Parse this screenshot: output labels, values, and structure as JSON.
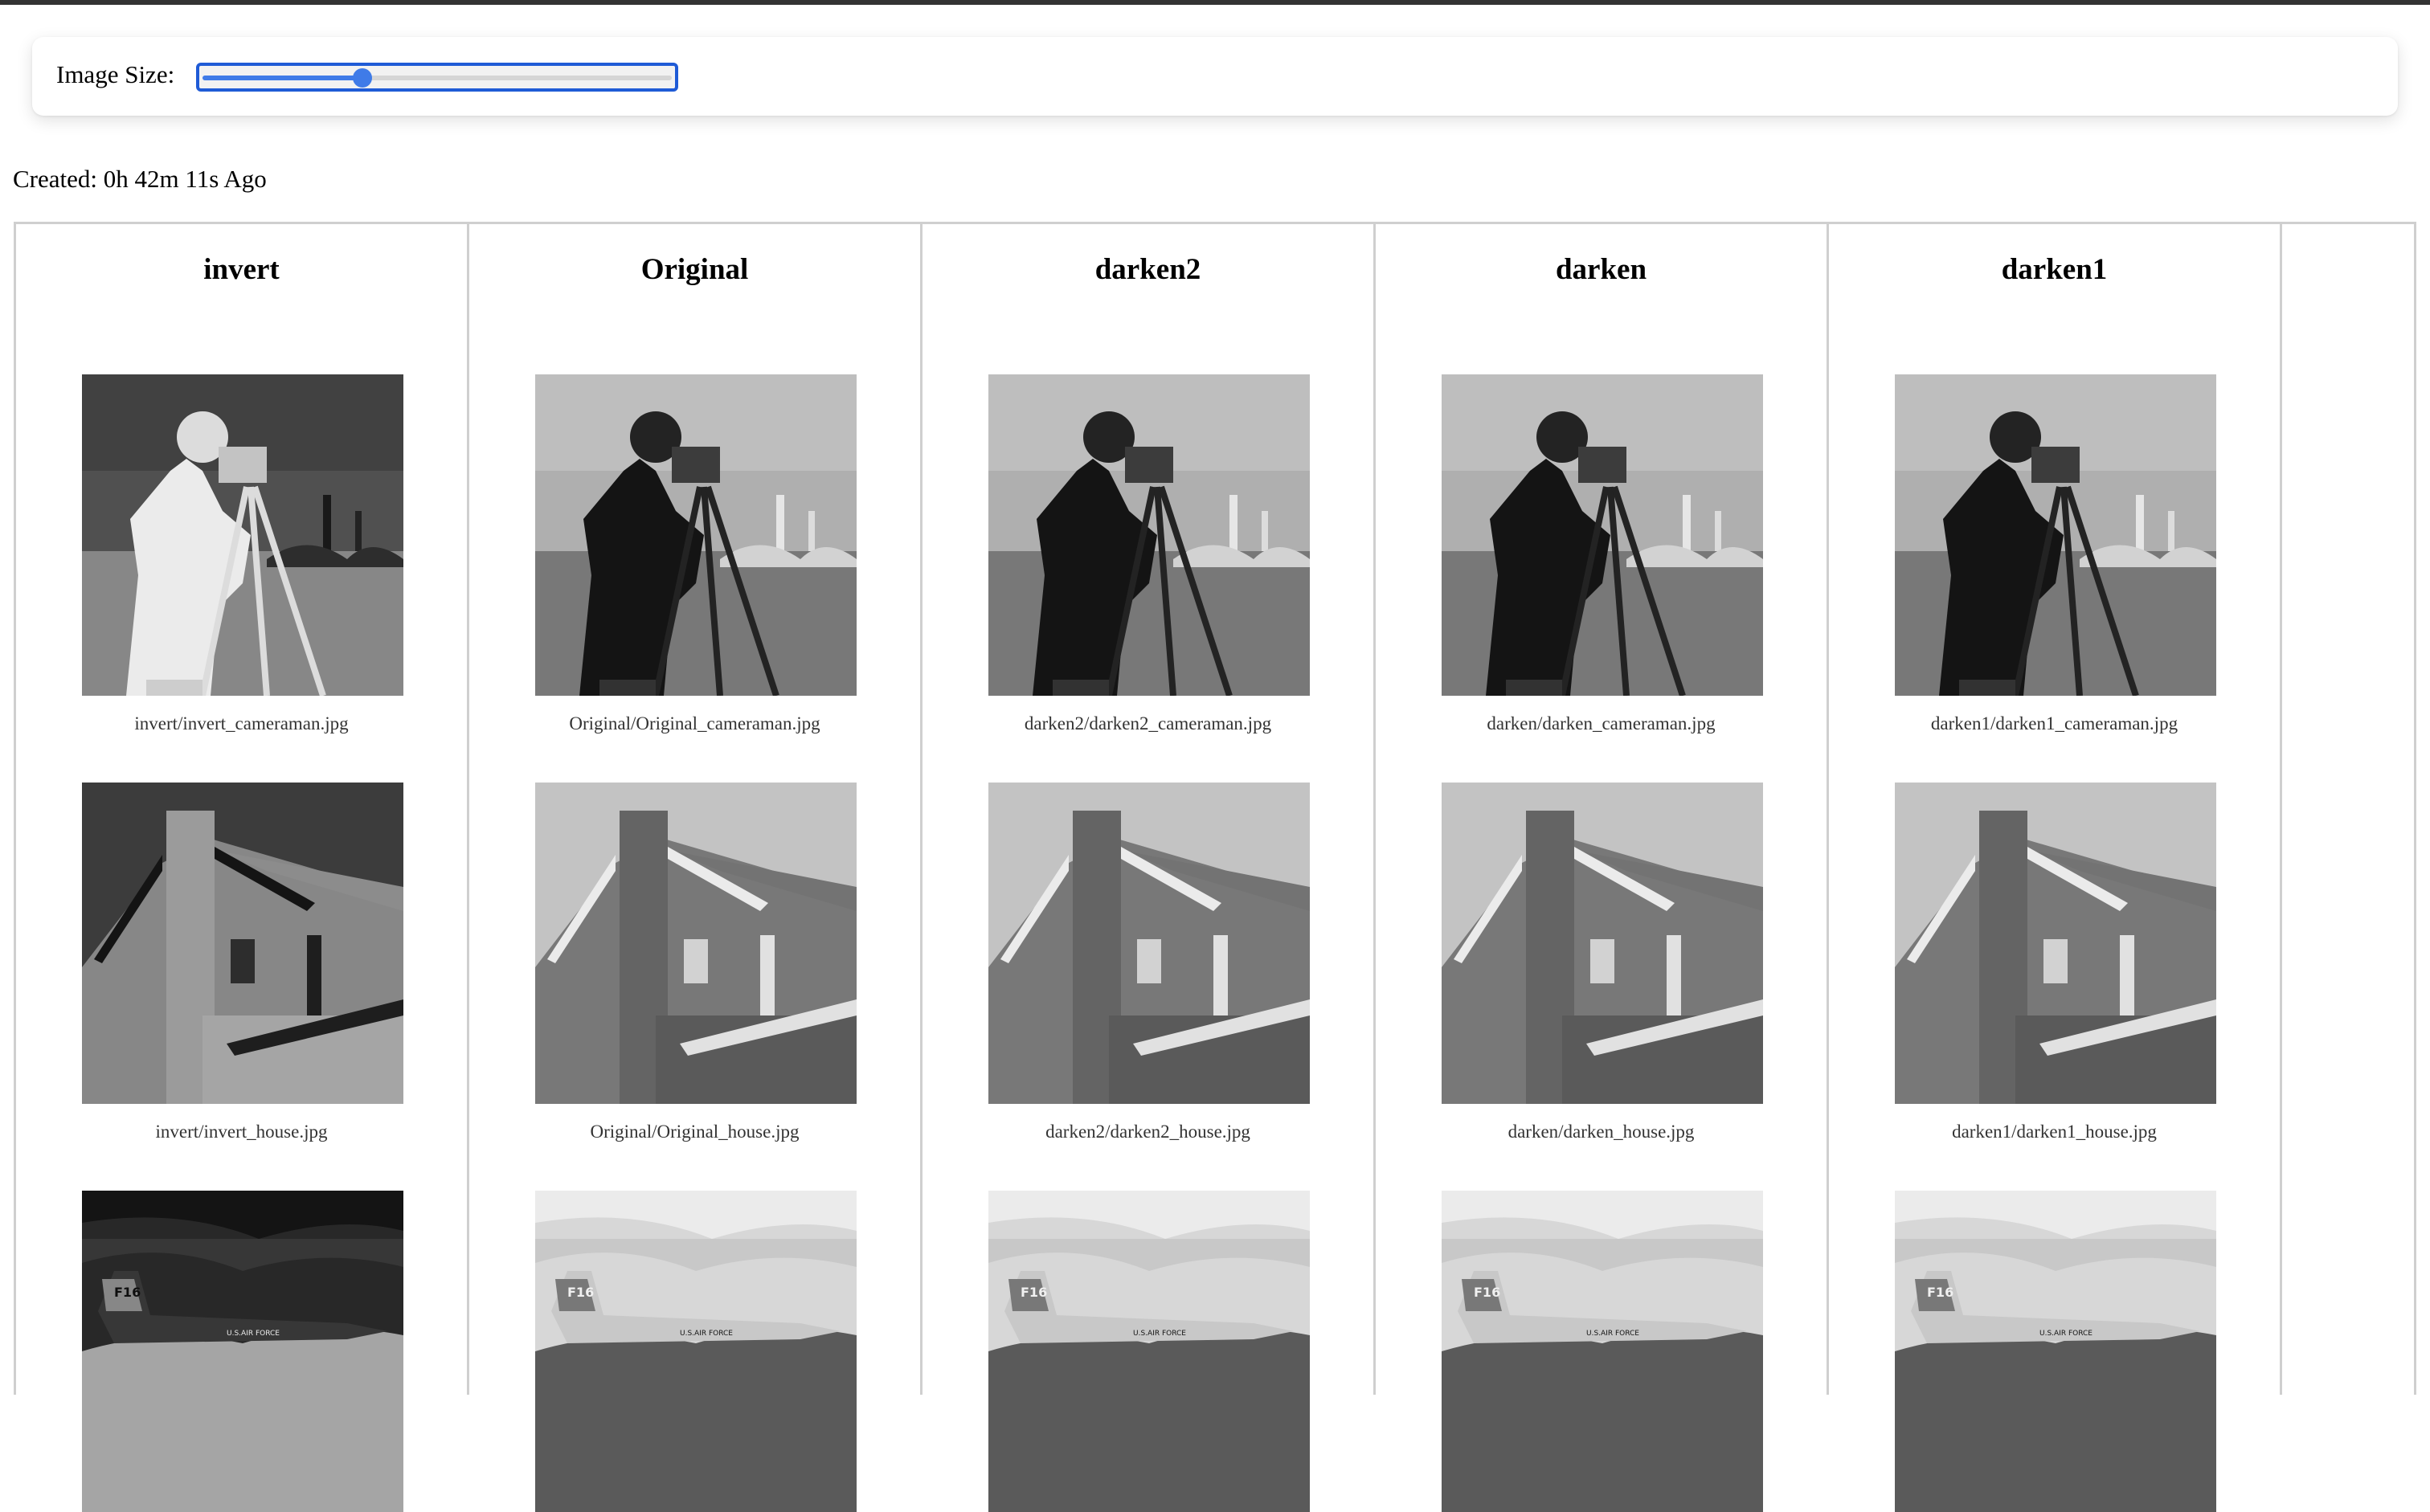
{
  "toolbar": {
    "image_size_label": "Image Size:",
    "image_size_value": 0.34
  },
  "created": "Created: 0h 42m 11s Ago",
  "columns": [
    {
      "title": "invert",
      "variant": "invert",
      "captions": [
        "invert/invert_cameraman.jpg",
        "invert/invert_house.jpg",
        ""
      ]
    },
    {
      "title": "Original",
      "variant": "original",
      "captions": [
        "Original/Original_cameraman.jpg",
        "Original/Original_house.jpg",
        ""
      ]
    },
    {
      "title": "darken2",
      "variant": "darken",
      "captions": [
        "darken2/darken2_cameraman.jpg",
        "darken2/darken2_house.jpg",
        ""
      ]
    },
    {
      "title": "darken",
      "variant": "darken",
      "captions": [
        "darken/darken_cameraman.jpg",
        "darken/darken_house.jpg",
        ""
      ]
    },
    {
      "title": "darken1",
      "variant": "darken",
      "captions": [
        "darken1/darken1_cameraman.jpg",
        "darken1/darken1_house.jpg",
        ""
      ]
    }
  ],
  "images": {
    "jet_text": "U.S.AIR FORCE",
    "jet_tail": "F16"
  }
}
